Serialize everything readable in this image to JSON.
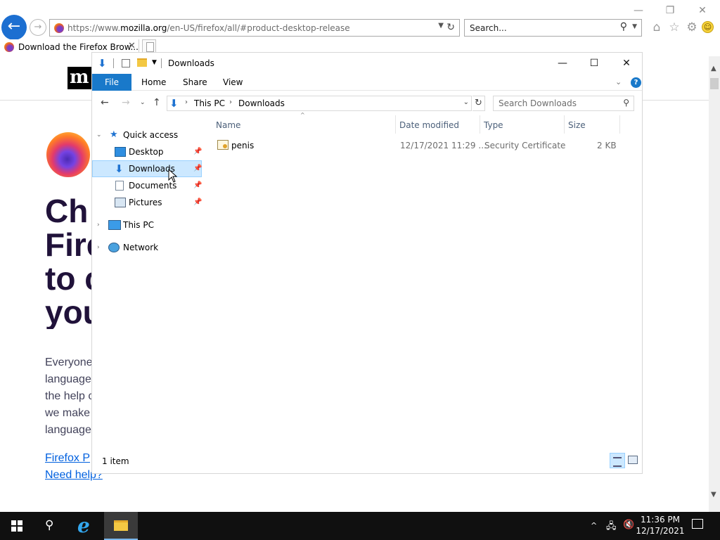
{
  "browser": {
    "url_prefix": "https://www.",
    "url_domain": "mozilla.org",
    "url_rest": "/en-US/firefox/all/#product-desktop-release",
    "search_placeholder": "Search...",
    "tab_title": "Download the Firefox Brow...",
    "tab_close": "✕"
  },
  "page": {
    "logo_letter": "m",
    "hero_lines": [
      "Ch",
      "Fire",
      "to c",
      "you"
    ],
    "paragraph_lines": [
      "Everyone",
      "language",
      "the help c",
      "we make",
      "language"
    ],
    "link_1": "Firefox P",
    "link_2": "Need help?"
  },
  "explorer": {
    "title": "Downloads",
    "ribbon": {
      "file": "File",
      "tabs": [
        "Home",
        "Share",
        "View"
      ]
    },
    "breadcrumb": [
      "This PC",
      "Downloads"
    ],
    "search_placeholder": "Search Downloads",
    "nav": {
      "quick_access": "Quick access",
      "items": [
        {
          "label": "Desktop",
          "icon": "desktop-icon"
        },
        {
          "label": "Downloads",
          "icon": "downloads-icon"
        },
        {
          "label": "Documents",
          "icon": "documents-icon"
        },
        {
          "label": "Pictures",
          "icon": "pictures-icon"
        }
      ],
      "this_pc": "This PC",
      "network": "Network"
    },
    "columns": [
      "Name",
      "Date modified",
      "Type",
      "Size"
    ],
    "files": [
      {
        "name": "penis",
        "date": "12/17/2021 11:29 ...",
        "type": "Security Certificate",
        "size": "2 KB",
        "icon": "certificate-icon"
      }
    ],
    "status": "1 item"
  },
  "taskbar": {
    "time": "11:36 PM",
    "date": "12/17/2021"
  },
  "colors": {
    "accent": "#1979ca",
    "selection": "#cce8ff",
    "taskbar": "#101010",
    "hero_text": "#20123a",
    "link": "#0060df"
  }
}
